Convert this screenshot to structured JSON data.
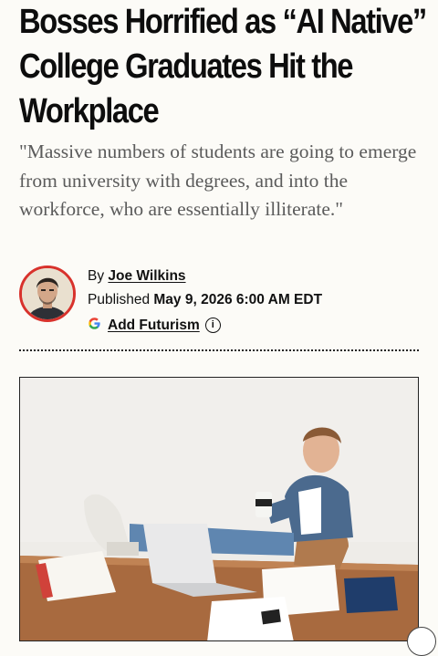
{
  "article": {
    "headline": "Bosses Horrified as “AI Native” College Graduates Hit the Workplace",
    "dek": "\"Massive numbers of students are going to emerge from university with degrees, and into the workforce, who are essentially illiterate.\"",
    "byline": {
      "prefix": "By",
      "author": "Joe Wilkins"
    },
    "published": {
      "prefix": "Published",
      "date": "May 9, 2026 6:00 AM EDT"
    },
    "add_futurism": {
      "google_letter": "G",
      "label": "Add Futurism",
      "info_glyph": "i"
    }
  },
  "icons": {
    "google": "google-g-icon",
    "info": "info-icon",
    "avatar": "author-avatar"
  },
  "colors": {
    "background": "#fcfbf7",
    "avatar_ring": "#d8322c",
    "dek_text": "#5b5b5b"
  }
}
